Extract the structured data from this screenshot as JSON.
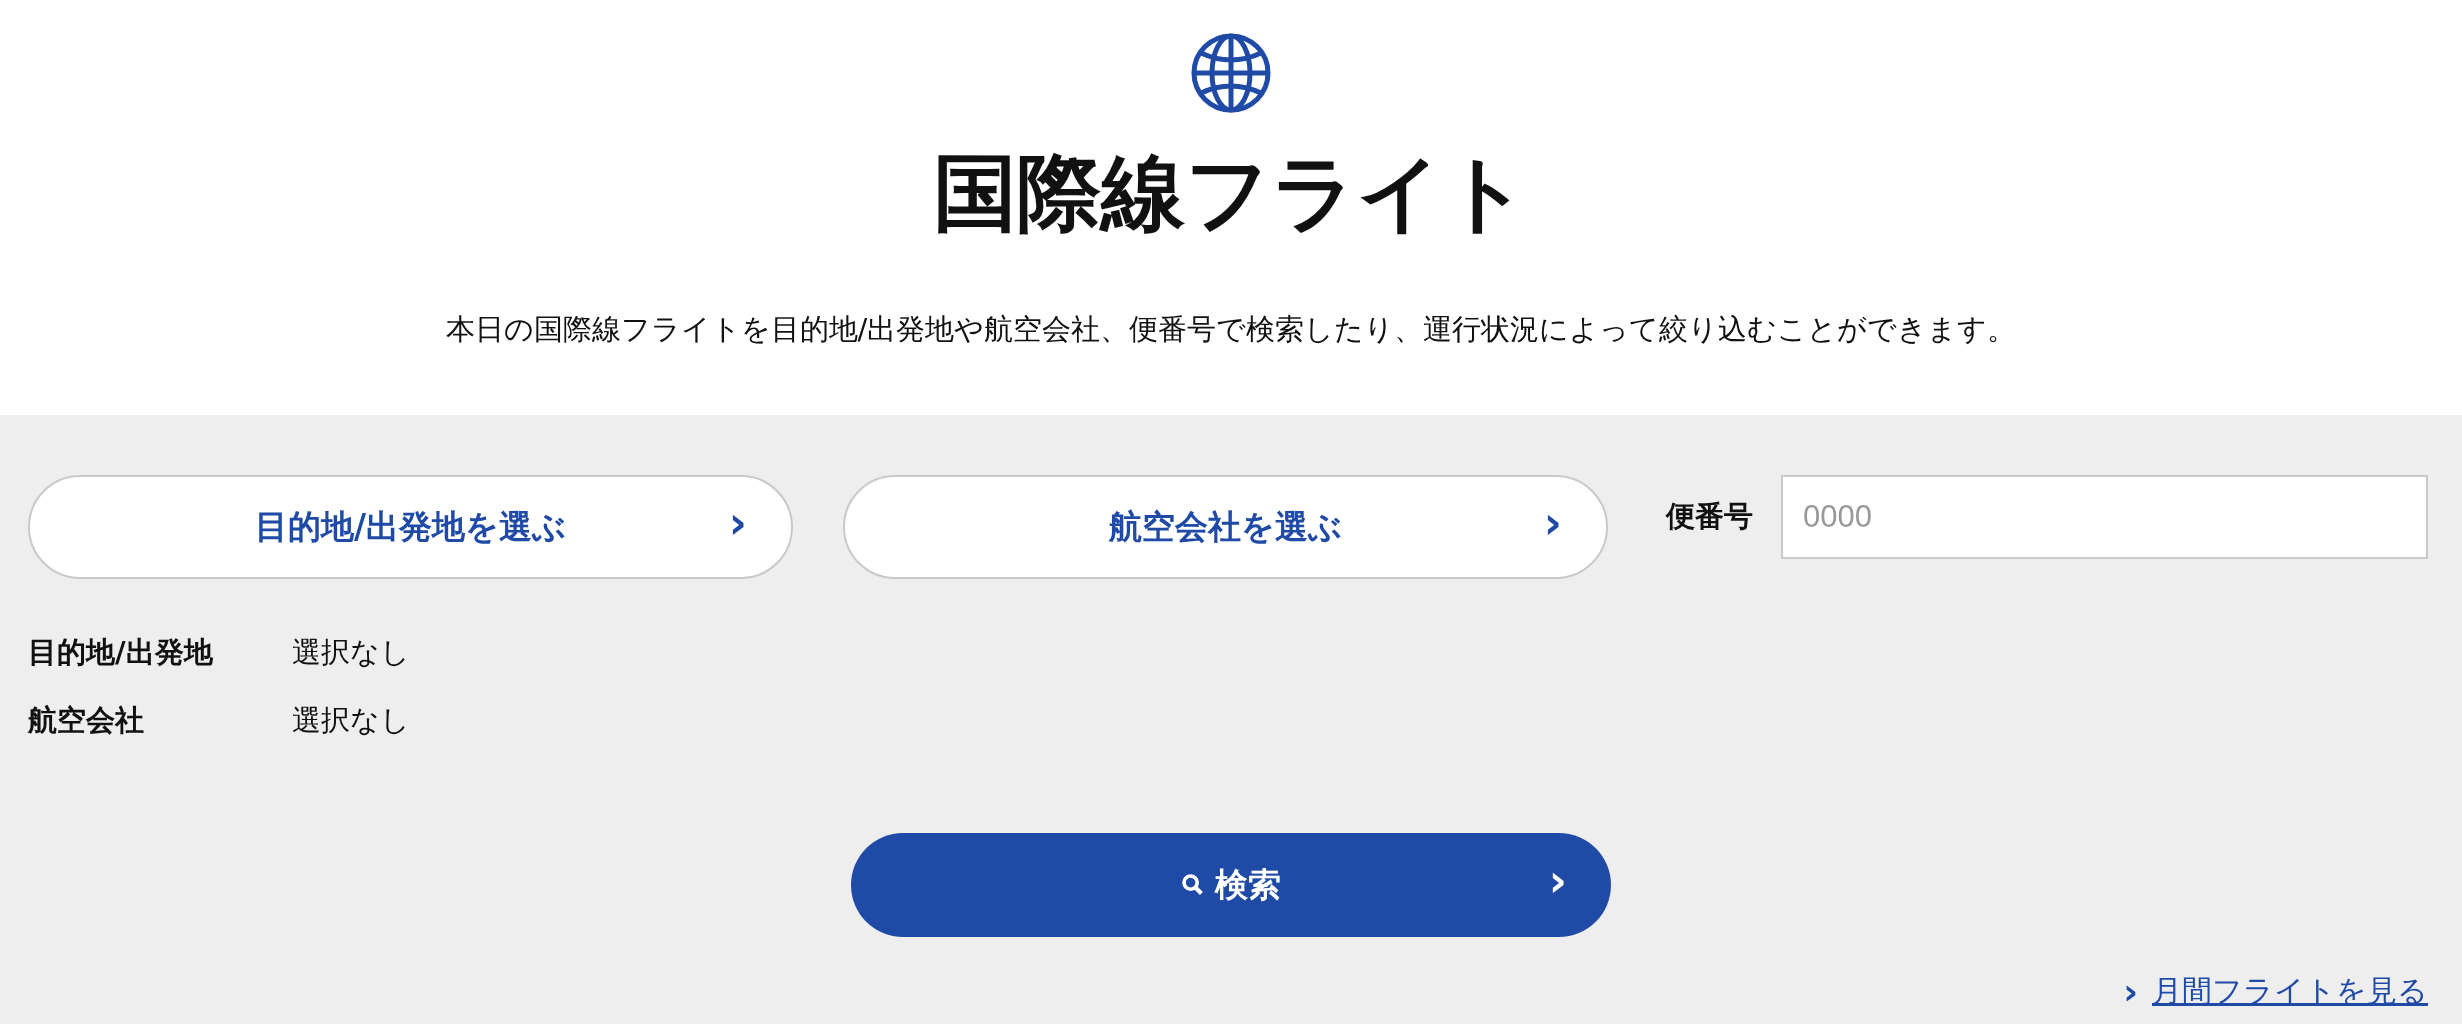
{
  "header": {
    "title": "国際線フライト",
    "description": "本日の国際線フライトを目的地/出発地や航空会社、便番号で検索したり、運行状況によって絞り込むことができます。"
  },
  "select_buttons": [
    {
      "label": "目的地/出発地を選ぶ",
      "chevron": "›"
    },
    {
      "label": "航空会社を選ぶ",
      "chevron": "›"
    }
  ],
  "flight_number": {
    "label": "便番号",
    "placeholder": "0000"
  },
  "selections": [
    {
      "label": "目的地/出発地",
      "value": "選択なし"
    },
    {
      "label": "航空会社",
      "value": "選択なし"
    }
  ],
  "search_button": {
    "label": "検索",
    "chevron": "›"
  },
  "monthly_link": {
    "chevron": "›",
    "label": "月間フライトを見る"
  }
}
